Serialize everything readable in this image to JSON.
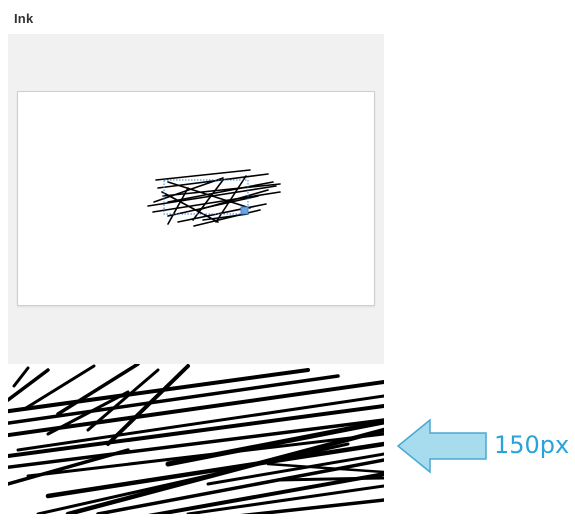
{
  "section": {
    "title": "Ink"
  },
  "annotation": {
    "label": "150px",
    "color": "#2aa3d8",
    "arrow_fill": "#a6dcee",
    "arrow_stroke": "#4aa8d2"
  },
  "colors": {
    "ink": "#000000",
    "selection": "#3a7fd4",
    "panel_bg": "#f1f1f1"
  }
}
